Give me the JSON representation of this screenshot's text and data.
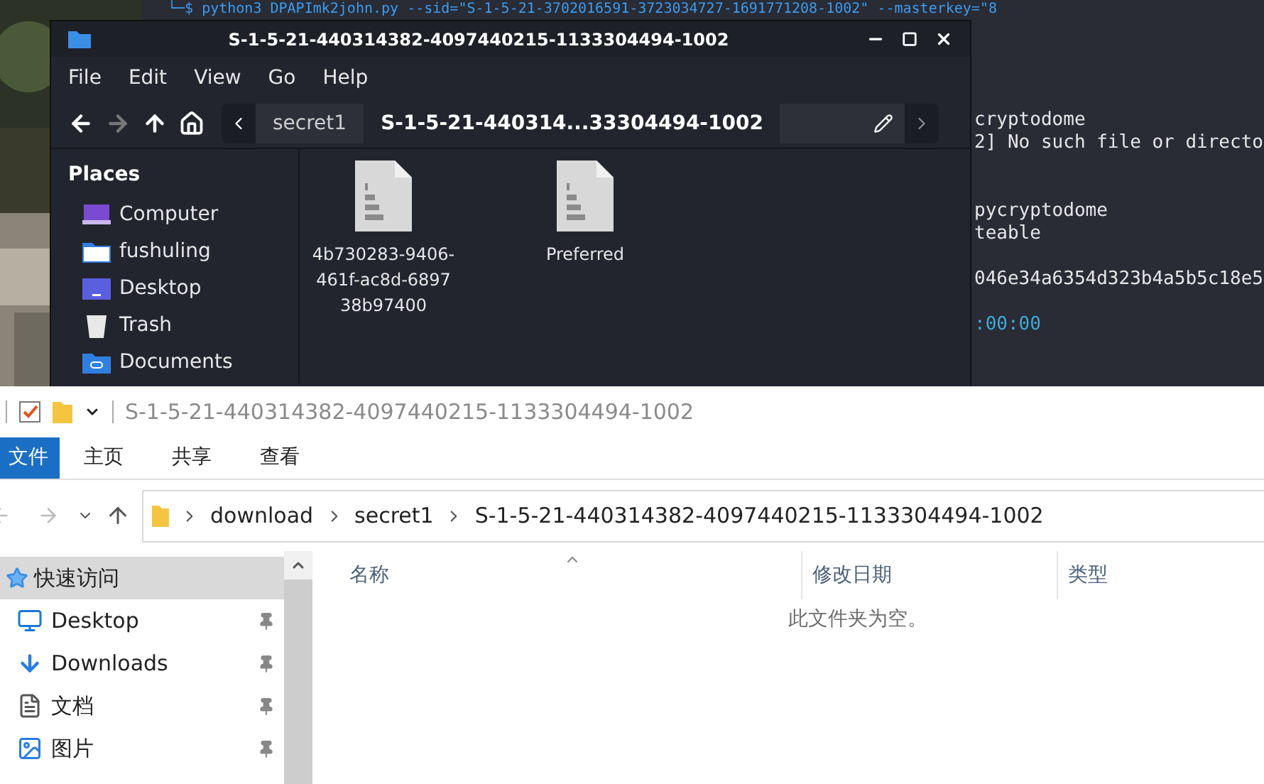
{
  "terminal": {
    "command_line": "└─$ python3 DPAPImk2john.py --sid=\"S-1-5-21-3702016591-3723034727-1691771208-1002\" --masterkey=\"8",
    "lines": [
      {
        "text": "cryptodome",
        "kind": "plain"
      },
      {
        "text": "2] No such file or directo",
        "kind": "plain"
      },
      {
        "kind": "blank"
      },
      {
        "kind": "blank"
      },
      {
        "text": "pycryptodome",
        "kind": "plain"
      },
      {
        "text": "teable",
        "kind": "plain"
      },
      {
        "kind": "blank"
      },
      {
        "text": "046e34a6354d323b4a5b5c18e5",
        "kind": "plain"
      },
      {
        "kind": "blank"
      },
      {
        "text": ":00:00",
        "kind": "accent"
      }
    ]
  },
  "file_manager": {
    "title": "S-1-5-21-440314382-4097440215-1133304494-1002",
    "menu": [
      "File",
      "Edit",
      "View",
      "Go",
      "Help"
    ],
    "path": [
      {
        "label": "secret1",
        "selected": false
      },
      {
        "label": "S-1-5-21-440314...33304494-1002",
        "selected": true
      }
    ],
    "sidebar": {
      "heading": "Places",
      "items": [
        {
          "label": "Computer",
          "kind": "computer"
        },
        {
          "label": "fushuling",
          "kind": "home"
        },
        {
          "label": "Desktop",
          "kind": "desktop"
        },
        {
          "label": "Trash",
          "kind": "trash"
        },
        {
          "label": "Documents",
          "kind": "documents"
        }
      ]
    },
    "files": [
      {
        "name": "4b730283-9406-461f-ac8d-689738b97400"
      },
      {
        "name": "Preferred"
      }
    ]
  },
  "explorer": {
    "title": "S-1-5-21-440314382-4097440215-1133304494-1002",
    "ribbon_tabs": [
      {
        "label": "文件",
        "selected": true
      },
      {
        "label": "主页",
        "selected": false
      },
      {
        "label": "共享",
        "selected": false
      },
      {
        "label": "查看",
        "selected": false
      }
    ],
    "breadcrumbs": [
      "download",
      "secret1",
      "S-1-5-21-440314382-4097440215-1133304494-1002"
    ],
    "nav": [
      {
        "label": "快速访问",
        "kind": "quick",
        "selected": true,
        "pinned": false
      },
      {
        "label": "Desktop",
        "kind": "desktop",
        "selected": false,
        "pinned": true
      },
      {
        "label": "Downloads",
        "kind": "downloads",
        "selected": false,
        "pinned": true
      },
      {
        "label": "文档",
        "kind": "documents",
        "selected": false,
        "pinned": true
      },
      {
        "label": "图片",
        "kind": "pictures",
        "selected": false,
        "pinned": true
      }
    ],
    "columns": [
      "名称",
      "修改日期",
      "类型"
    ],
    "empty_message": "此文件夹为空。"
  }
}
